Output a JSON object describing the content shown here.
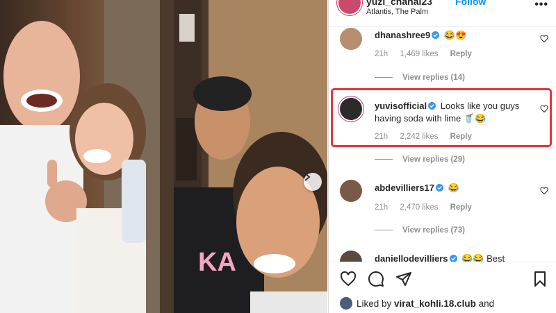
{
  "post": {
    "username": "yuzi_chahal23",
    "follow_label": "Follow",
    "location": "Atlantis, The Palm",
    "more_label": "•••"
  },
  "comments": [
    {
      "username": "dhanashree9",
      "verified": true,
      "text": "😂😍",
      "time": "21h",
      "likes": "1,469 likes",
      "reply_label": "Reply",
      "view_replies": "View replies (14)"
    },
    {
      "username": "yuvisofficial",
      "verified": true,
      "text": "Looks like you guys having soda with lime 🥤😂",
      "time": "21h",
      "likes": "2,242 likes",
      "reply_label": "Reply",
      "view_replies": "View replies (29)"
    },
    {
      "username": "abdevilliers17",
      "verified": true,
      "text": "😂",
      "time": "21h",
      "likes": "2,470 likes",
      "reply_label": "Reply",
      "view_replies": "View replies (73)"
    },
    {
      "username": "daniellodevilliers",
      "verified": true,
      "text": "😂😂 Best",
      "time": "",
      "likes": "",
      "reply_label": "",
      "view_replies": ""
    }
  ],
  "liked_by": {
    "prefix": "Liked by ",
    "user": "virat_kohli.18.club",
    "suffix": " and"
  },
  "colors": {
    "follow_blue": "#0095f6",
    "highlight_red": "#e8343f",
    "meta_gray": "#8e8e8e",
    "verified_blue": "#3897f0"
  },
  "icons": [
    "heart-icon",
    "comment-icon",
    "share-icon",
    "bookmark-icon",
    "verified-icon",
    "chevron-right-icon"
  ]
}
